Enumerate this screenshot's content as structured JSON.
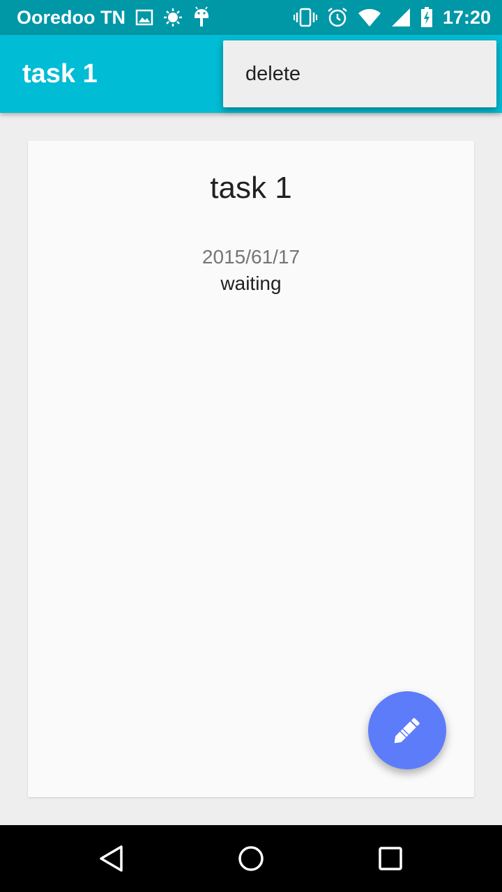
{
  "status_bar": {
    "carrier": "Ooredoo TN",
    "time": "17:20",
    "icons": [
      "image-notification-icon",
      "brightness-icon",
      "android-debug-icon",
      "vibrate-icon",
      "alarm-icon",
      "wifi-icon",
      "cell-signal-icon",
      "battery-charging-icon"
    ]
  },
  "app_bar": {
    "title": "task 1"
  },
  "overflow_menu": {
    "items": [
      {
        "label": "delete"
      }
    ]
  },
  "task": {
    "title": "task 1",
    "date": "2015/61/17",
    "status": "waiting"
  },
  "fab": {
    "icon": "pencil-icon"
  },
  "nav_bar": {
    "icons": [
      "back-icon",
      "home-icon",
      "recent-apps-icon"
    ]
  },
  "colors": {
    "status_bar": "#0097a7",
    "app_bar": "#00bcd4",
    "fab": "#5c7cfa",
    "background": "#eeeeee",
    "card": "#fafafa"
  }
}
